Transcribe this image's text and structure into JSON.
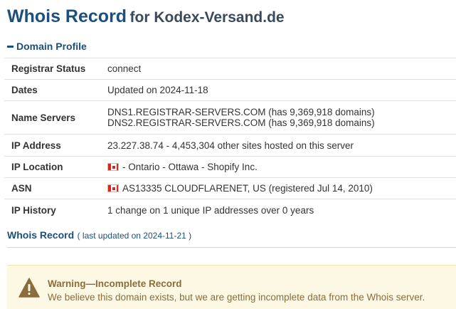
{
  "header": {
    "title": "Whois Record",
    "subtitle": "for Kodex-Versand.de"
  },
  "domain_profile": {
    "section_title": "Domain Profile",
    "rows": [
      {
        "label": "Registrar Status",
        "value": "connect"
      },
      {
        "label": "Dates",
        "value": "Updated on 2024-11-18"
      },
      {
        "label": "Name Servers",
        "value_lines": [
          "DNS1.REGISTRAR-SERVERS.COM (has 9,369,918 domains)",
          "DNS2.REGISTRAR-SERVERS.COM (has 9,369,918 domains)"
        ]
      },
      {
        "label": "IP Address",
        "value": "23.227.38.74 - 4,453,304 other sites hosted on this server"
      },
      {
        "label": "IP Location",
        "value": "- Ontario - Ottawa - Shopify Inc.",
        "flag": "canada-flag-icon"
      },
      {
        "label": "ASN",
        "value": "AS13335 CLOUDFLARENET, US (registered Jul 14, 2010)",
        "flag": "canada-flag-icon"
      },
      {
        "label": "IP History",
        "value": "1 change on 1 unique IP addresses over 0 years"
      }
    ]
  },
  "whois_record": {
    "title": "Whois Record",
    "last_updated": "( last updated on 2024-11-21 )"
  },
  "warning": {
    "icon": "warning-triangle-icon",
    "title": "Warning—Incomplete Record",
    "text": "We believe this domain exists, but we are getting incomplete data from the Whois server."
  },
  "colors": {
    "link_blue": "#1d4f7c",
    "warning_bg": "#fcf8e3",
    "warning_text": "#8a6d3b",
    "warning_icon": "#8a6d3b"
  }
}
